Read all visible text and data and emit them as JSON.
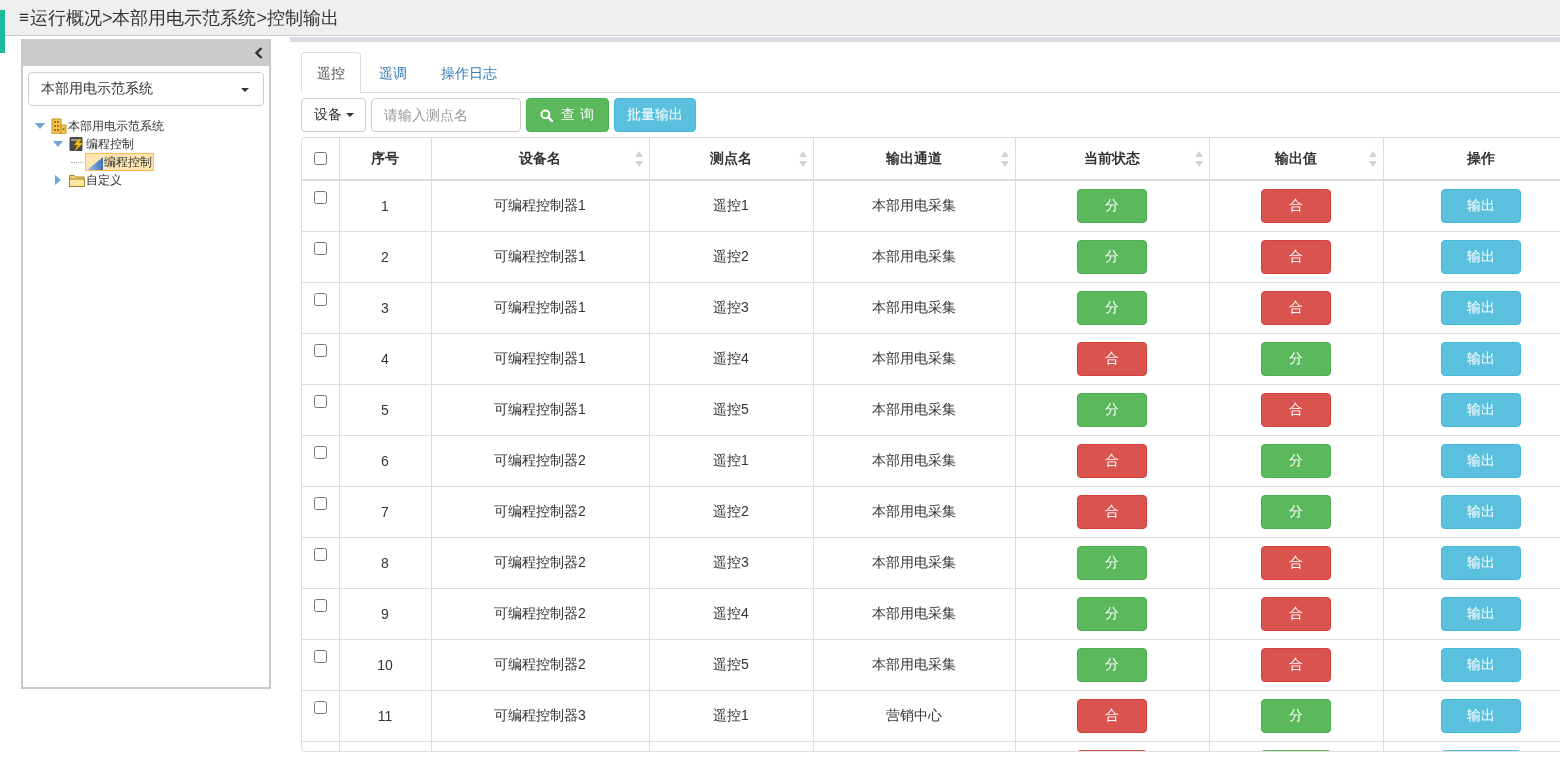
{
  "header": {
    "menu_glyph": "≡",
    "breadcrumb": "运行概况>本部用电示范系统>控制输出"
  },
  "sidebar": {
    "selector": {
      "value": "本部用电示范系统"
    },
    "tree": [
      {
        "label": "本部用电示范系统",
        "kind": "station",
        "expanded": true,
        "selected": false,
        "children": [
          {
            "label": "编程控制",
            "kind": "device",
            "expanded": true,
            "selected": false,
            "children": [
              {
                "label": "编程控制",
                "kind": "point",
                "selected": true
              }
            ]
          },
          {
            "label": "自定义",
            "kind": "folder",
            "expanded": false,
            "selected": false
          }
        ]
      }
    ]
  },
  "tabs": [
    {
      "label": "遥控",
      "selected": true
    },
    {
      "label": "遥调",
      "selected": false
    },
    {
      "label": "操作日志",
      "selected": false
    }
  ],
  "toolbar": {
    "filter_dropdown": {
      "label": "设备"
    },
    "search": {
      "placeholder": "请输入测点名"
    },
    "query_button": {
      "label": "查 询"
    },
    "batch_button": {
      "label": "批量输出"
    }
  },
  "table": {
    "columns": [
      {
        "kind": "checkbox",
        "checked": false
      },
      {
        "kind": "text",
        "label": "序号",
        "sortable": false
      },
      {
        "kind": "text",
        "label": "设备名",
        "sortable": true
      },
      {
        "kind": "text",
        "label": "测点名",
        "sortable": true
      },
      {
        "kind": "text",
        "label": "输出通道",
        "sortable": true
      },
      {
        "kind": "text",
        "label": "当前状态",
        "sortable": true
      },
      {
        "kind": "text",
        "label": "输出值",
        "sortable": true
      },
      {
        "kind": "text",
        "label": "操作",
        "sortable": false
      }
    ],
    "rows": [
      {
        "checked": false,
        "index": "1",
        "device": "可编程控制器1",
        "point": "遥控1",
        "channel": "本部用电采集",
        "current_state": {
          "kind": "open",
          "label": "分"
        },
        "output_value": {
          "kind": "closed",
          "label": "合"
        },
        "action": "输出"
      },
      {
        "checked": false,
        "index": "2",
        "device": "可编程控制器1",
        "point": "遥控2",
        "channel": "本部用电采集",
        "current_state": {
          "kind": "open",
          "label": "分"
        },
        "output_value": {
          "kind": "closed",
          "label": "合"
        },
        "action": "输出"
      },
      {
        "checked": false,
        "index": "3",
        "device": "可编程控制器1",
        "point": "遥控3",
        "channel": "本部用电采集",
        "current_state": {
          "kind": "open",
          "label": "分"
        },
        "output_value": {
          "kind": "closed",
          "label": "合"
        },
        "action": "输出"
      },
      {
        "checked": false,
        "index": "4",
        "device": "可编程控制器1",
        "point": "遥控4",
        "channel": "本部用电采集",
        "current_state": {
          "kind": "closed",
          "label": "合"
        },
        "output_value": {
          "kind": "open",
          "label": "分"
        },
        "action": "输出"
      },
      {
        "checked": false,
        "index": "5",
        "device": "可编程控制器1",
        "point": "遥控5",
        "channel": "本部用电采集",
        "current_state": {
          "kind": "open",
          "label": "分"
        },
        "output_value": {
          "kind": "closed",
          "label": "合"
        },
        "action": "输出"
      },
      {
        "checked": false,
        "index": "6",
        "device": "可编程控制器2",
        "point": "遥控1",
        "channel": "本部用电采集",
        "current_state": {
          "kind": "closed",
          "label": "合"
        },
        "output_value": {
          "kind": "open",
          "label": "分"
        },
        "action": "输出"
      },
      {
        "checked": false,
        "index": "7",
        "device": "可编程控制器2",
        "point": "遥控2",
        "channel": "本部用电采集",
        "current_state": {
          "kind": "closed",
          "label": "合"
        },
        "output_value": {
          "kind": "open",
          "label": "分"
        },
        "action": "输出"
      },
      {
        "checked": false,
        "index": "8",
        "device": "可编程控制器2",
        "point": "遥控3",
        "channel": "本部用电采集",
        "current_state": {
          "kind": "open",
          "label": "分"
        },
        "output_value": {
          "kind": "closed",
          "label": "合"
        },
        "action": "输出"
      },
      {
        "checked": false,
        "index": "9",
        "device": "可编程控制器2",
        "point": "遥控4",
        "channel": "本部用电采集",
        "current_state": {
          "kind": "open",
          "label": "分"
        },
        "output_value": {
          "kind": "closed",
          "label": "合"
        },
        "action": "输出"
      },
      {
        "checked": false,
        "index": "10",
        "device": "可编程控制器2",
        "point": "遥控5",
        "channel": "本部用电采集",
        "current_state": {
          "kind": "open",
          "label": "分"
        },
        "output_value": {
          "kind": "closed",
          "label": "合"
        },
        "action": "输出"
      },
      {
        "checked": false,
        "index": "11",
        "device": "可编程控制器3",
        "point": "遥控1",
        "channel": "营销中心",
        "current_state": {
          "kind": "closed",
          "label": "合"
        },
        "output_value": {
          "kind": "open",
          "label": "分"
        },
        "action": "输出"
      }
    ],
    "cut_row": {
      "current_state": {
        "kind": "closed"
      },
      "output_value": {
        "kind": "open"
      }
    }
  }
}
